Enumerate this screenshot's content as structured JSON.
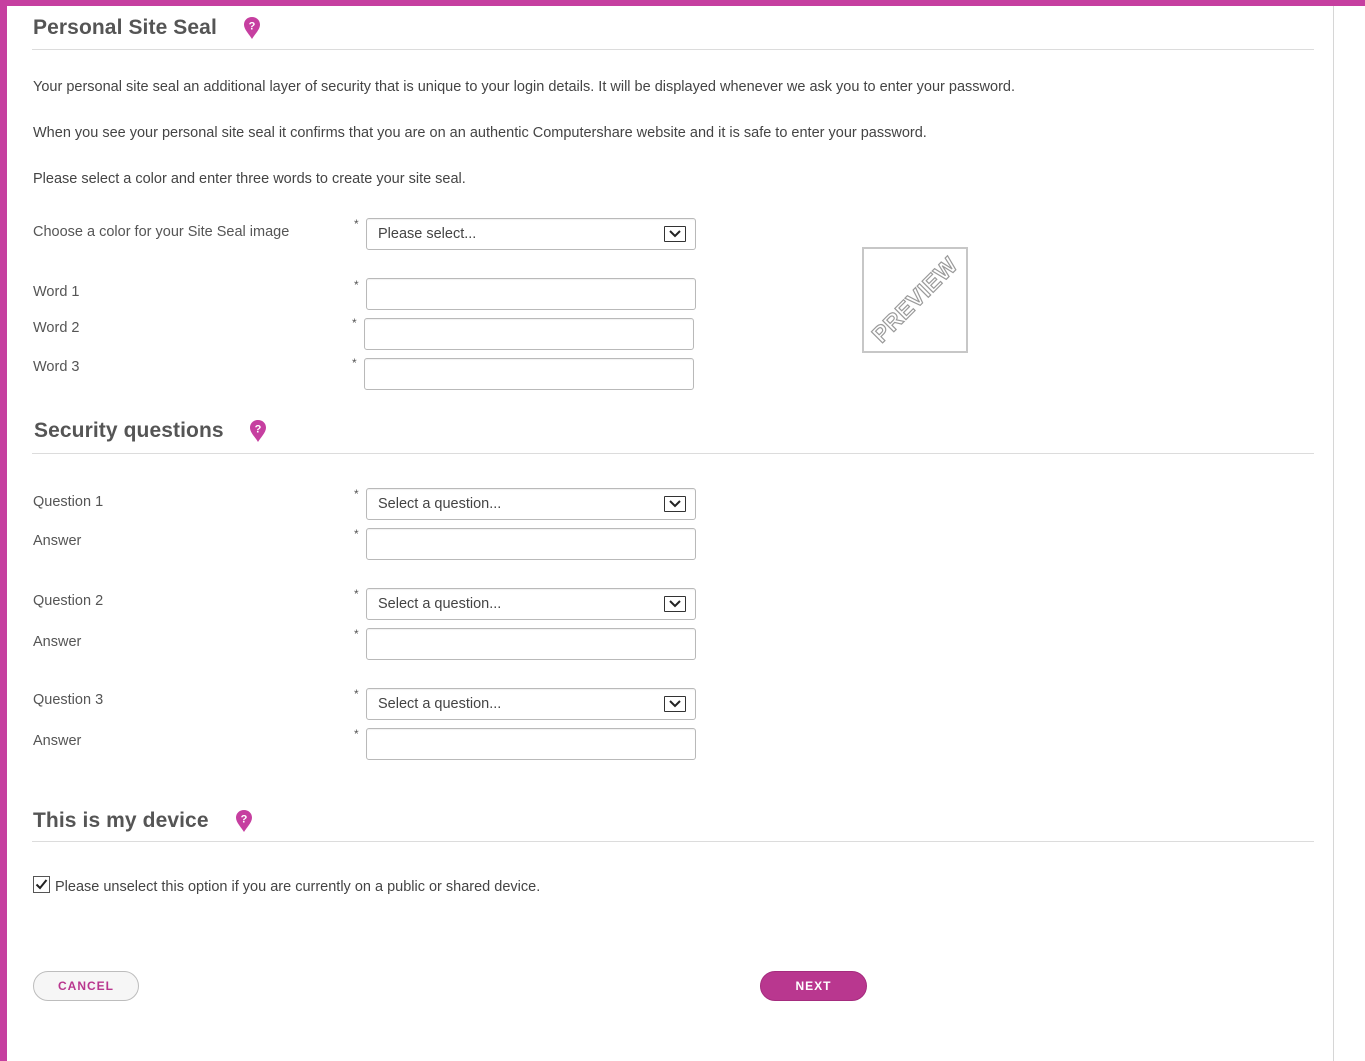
{
  "theme": {
    "accent": "#c63fa0",
    "button_primary": "#b9378f"
  },
  "site_seal": {
    "title": "Personal Site Seal",
    "help_icon": "help-pin-icon",
    "para1": "Your personal site seal an additional layer of security that is unique to your login details. It will be displayed whenever we ask you to enter your password.",
    "para2": "When you see your personal site seal it confirms that you are on an authentic Computershare website and it is safe to enter your password.",
    "para3": "Please select a color and enter three words to create your site seal.",
    "color_label": "Choose a color for your Site Seal image",
    "color_value": "Please select...",
    "word1_label": "Word 1",
    "word2_label": "Word 2",
    "word3_label": "Word 3",
    "word1_value": "",
    "word2_value": "",
    "word3_value": "",
    "preview_text": "PREVIEW",
    "required_mark": "*"
  },
  "security": {
    "title": "Security questions",
    "questions": [
      {
        "label": "Question 1",
        "value": "Select a question...",
        "answer_label": "Answer",
        "answer_value": ""
      },
      {
        "label": "Question 2",
        "value": "Select a question...",
        "answer_label": "Answer",
        "answer_value": ""
      },
      {
        "label": "Question 3",
        "value": "Select a question...",
        "answer_label": "Answer",
        "answer_value": ""
      }
    ]
  },
  "device": {
    "title": "This is my device",
    "checkbox_label": "Please unselect this option if you are currently on a public or shared device.",
    "checked": true
  },
  "buttons": {
    "cancel": "CANCEL",
    "next": "NEXT"
  }
}
